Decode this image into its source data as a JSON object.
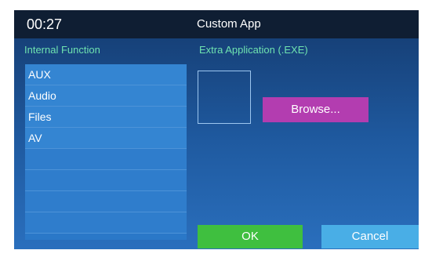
{
  "header": {
    "clock": "00:27",
    "title": "Custom App"
  },
  "internal_function": {
    "label": "Internal Function",
    "items": [
      "AUX",
      "Audio",
      "Files",
      "AV",
      "",
      "",
      "",
      ""
    ]
  },
  "extra_application": {
    "label": "Extra Application (.EXE)",
    "browse_label": "Browse..."
  },
  "actions": {
    "ok_label": "OK",
    "cancel_label": "Cancel"
  },
  "colors": {
    "accent_label": "#6fe3b0",
    "browse": "#b33db0",
    "ok": "#3fbf3f",
    "cancel": "#49aee6"
  }
}
